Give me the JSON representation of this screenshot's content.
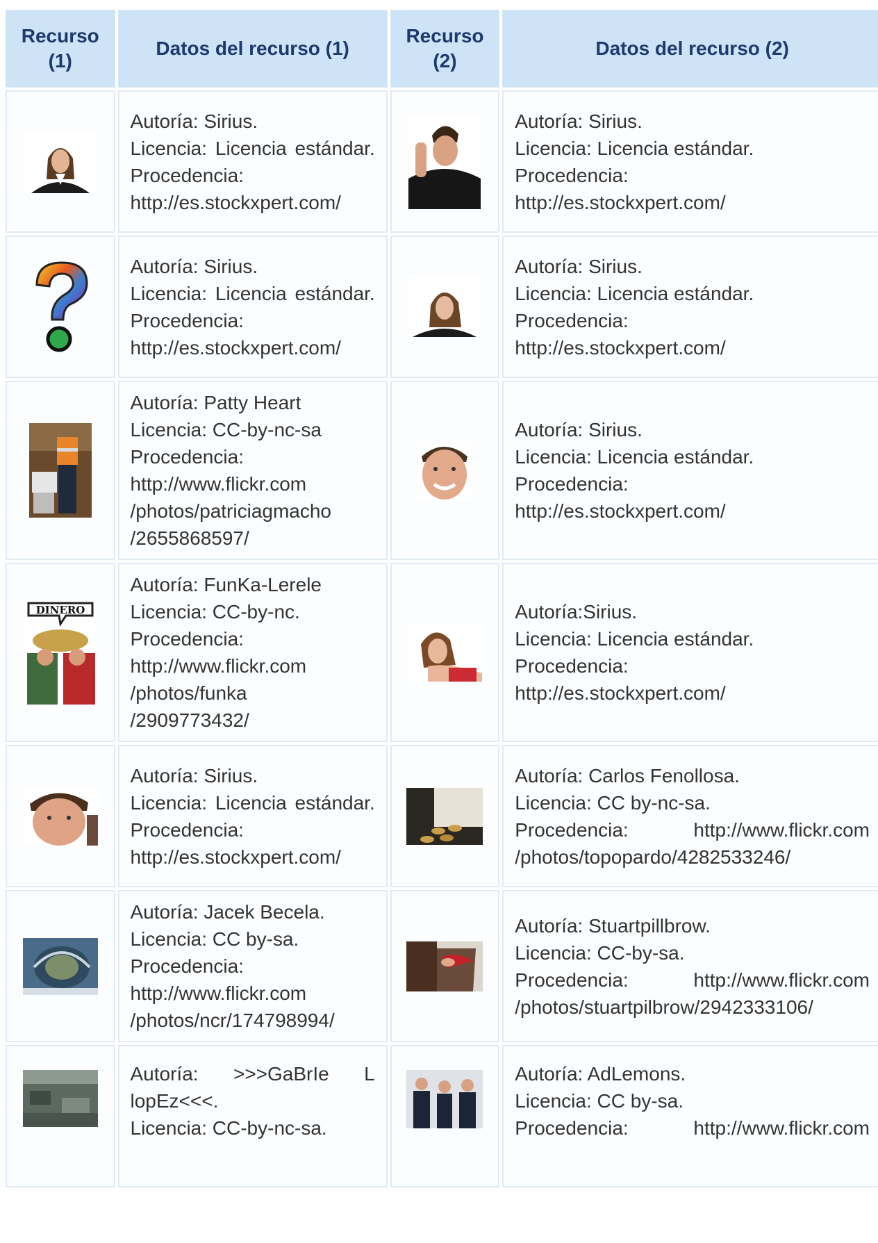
{
  "header": {
    "col1": "Recurso (1)",
    "col2": "Datos del recurso (1)",
    "col3": "Recurso (2)",
    "col4": "Datos del recurso (2)"
  },
  "rows": [
    {
      "img1": "woman-portrait-icon",
      "d1": [
        "Autoría: Sirius.",
        "Licencia: Licencia estándar.",
        "Procedencia:",
        "http://es.stockxpert.com/"
      ],
      "img2": "man-thinking-icon",
      "d2": [
        "Autoría: Sirius.",
        "Licencia: Licencia estándar.",
        "Procedencia:",
        "http://es.stockxpert.com/"
      ]
    },
    {
      "img1": "question-mark-icon",
      "d1": [
        "Autoría: Sirius.",
        "Licencia: Licencia estándar.",
        "Procedencia:",
        "http://es.stockxpert.com/"
      ],
      "img2": "woman-thinking-icon",
      "d2": [
        "Autoría: Sirius.",
        "Licencia: Licencia estándar.",
        "Procedencia:",
        "http://es.stockxpert.com/"
      ]
    },
    {
      "img1": "paramedics-photo-icon",
      "d1": [
        "Autoría: Patty Heart",
        "Licencia: CC-by-nc-sa",
        "Procedencia:",
        "http://www.flickr.com",
        "/photos/patriciagmacho",
        "/2655868597/"
      ],
      "img2": "smiling-man-icon",
      "d2": [
        "Autoría: Sirius.",
        "Licencia: Licencia estándar.",
        "Procedencia:",
        "http://es.stockxpert.com/"
      ]
    },
    {
      "img1": "dinero-poster-icon",
      "img1_text": "DINERO",
      "d1": [
        "Autoría: FunKa-Lerele",
        "Licencia: CC-by-nc.",
        "Procedencia:",
        "http://www.flickr.com",
        "/photos/funka",
        "/2909773432/"
      ],
      "img2": "woman-leaning-icon",
      "d2": [
        "Autoría:Sirius.",
        "Licencia: Licencia estándar.",
        "Procedencia:",
        "http://es.stockxpert.com/"
      ]
    },
    {
      "img1": "young-man-portrait-icon",
      "d1": [
        "Autoría: Sirius.",
        "Licencia: Licencia estándar.",
        "Procedencia:",
        "http://es.stockxpert.com/"
      ],
      "img2": "coins-photo-icon",
      "d2": [
        "Autoría: Carlos Fenollosa.",
        "Licencia: CC by-nc-sa.",
        "Procedencia: http://www.flickr.com",
        "/photos/topopardo/4282533246/"
      ]
    },
    {
      "img1": "spiral-stairs-icon",
      "d1": [
        "Autoría: Jacek Becela.",
        "Licencia: CC by-sa.",
        "Procedencia:",
        "http://www.flickr.com",
        "/photos/ncr/174798994/"
      ],
      "img2": "wallet-pocket-icon",
      "d2": [
        "Autoría: Stuartpillbrow.",
        "Licencia: CC-by-sa.",
        "Procedencia: http://www.flickr.com",
        "/photos/stuartpilbrow/2942333106/"
      ]
    },
    {
      "img1": "crowd-photo-icon",
      "d1": [
        "Autoría: >>>GaBrIe L lopEz<<<.",
        "Licencia: CC-by-nc-sa."
      ],
      "img2": "businessmen-photo-icon",
      "d2": [
        "Autoría: AdLemons.",
        "Licencia: CC by-sa.",
        "Procedencia: http://www.flickr.com"
      ]
    }
  ]
}
